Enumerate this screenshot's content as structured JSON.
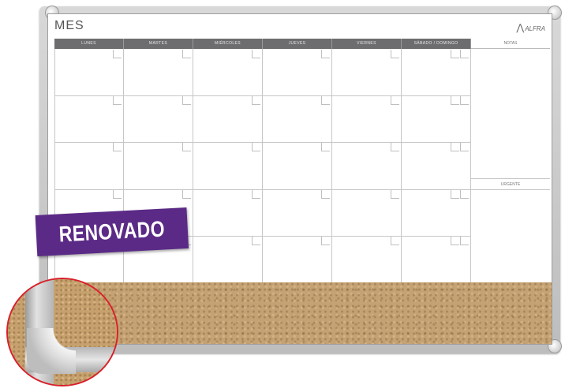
{
  "board": {
    "title": "MES",
    "brand": "ALFRA",
    "days": [
      "LUNES",
      "MARTES",
      "MIÉRCOLES",
      "JUEVES",
      "VIERNES",
      "SÁBADO / DOMINGO"
    ],
    "notes_label": "NOTAS",
    "urgent_label": "URGENTE",
    "weeks": 5
  },
  "badge": {
    "text": "RENOVADO",
    "color": "#5b2a86"
  },
  "highlight": {
    "ring_color": "#d8202a"
  },
  "colors": {
    "header": "#6d6d70",
    "cork": "#c4a274"
  }
}
